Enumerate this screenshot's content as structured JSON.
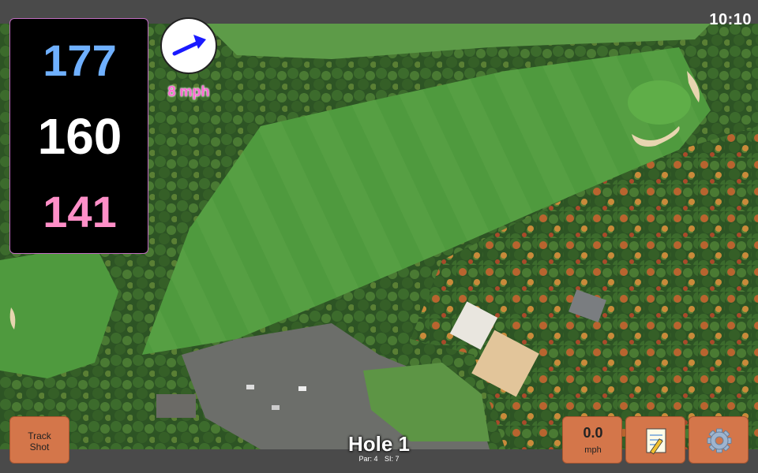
{
  "status": {
    "time": "10:10"
  },
  "yardages": {
    "back": "177",
    "middle": "160",
    "front": "141"
  },
  "wind": {
    "speed_label": "8 mph",
    "direction_icon": "wind-arrow-icon"
  },
  "hole": {
    "title": "Hole 1",
    "par_label": "Par: 4",
    "si_label": "SI: 7"
  },
  "buttons": {
    "track_shot_line1": "Track",
    "track_shot_line2": "Shot",
    "wind_value": "0.0",
    "wind_unit": "mph",
    "notes_icon": "notepad-icon",
    "settings_icon": "gear-icon"
  },
  "colors": {
    "back_yardage": "#6fb0ff",
    "middle_yardage": "#ffffff",
    "front_yardage": "#ff8fc8",
    "button": "#d4764a",
    "wind_label": "#ff6ad5"
  }
}
